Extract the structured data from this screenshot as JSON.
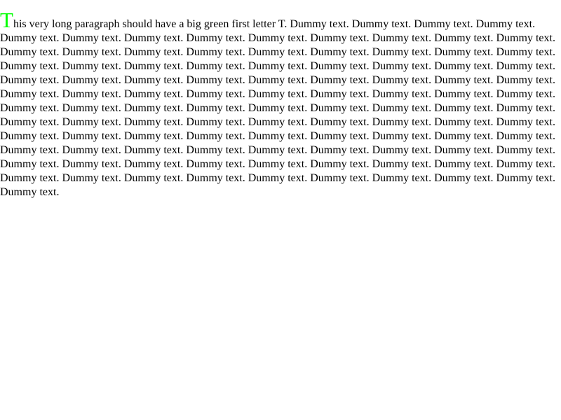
{
  "paragraph": {
    "first_letter": "T",
    "first_letter_color": "#00ff00",
    "lines": [
      "his very long paragraph should have a big green first letter T. Dummy text. Dummy text. Dummy text. Dummy text.",
      "Dummy text. Dummy text. Dummy text. Dummy text. Dummy text. Dummy text. Dummy text. Dummy text. Dummy text.",
      "Dummy text. Dummy text. Dummy text. Dummy text. Dummy text. Dummy text. Dummy text. Dummy text. Dummy text.",
      "Dummy text. Dummy text. Dummy text. Dummy text. Dummy text. Dummy text. Dummy text. Dummy text. Dummy text.",
      "Dummy text. Dummy text. Dummy text. Dummy text. Dummy text. Dummy text. Dummy text. Dummy text. Dummy text.",
      "Dummy text. Dummy text. Dummy text. Dummy text. Dummy text. Dummy text. Dummy text. Dummy text. Dummy text.",
      "Dummy text. Dummy text. Dummy text. Dummy text. Dummy text. Dummy text. Dummy text. Dummy text. Dummy text.",
      "Dummy text. Dummy text. Dummy text. Dummy text. Dummy text. Dummy text. Dummy text. Dummy text. Dummy text.",
      "Dummy text. Dummy text. Dummy text. Dummy text. Dummy text. Dummy text. Dummy text. Dummy text. Dummy text.",
      "Dummy text. Dummy text. Dummy text. Dummy text. Dummy text. Dummy text. Dummy text. Dummy text. Dummy text.",
      "Dummy text. Dummy text. Dummy text. Dummy text. Dummy text. Dummy text. Dummy text. Dummy text. Dummy text.",
      "Dummy text. Dummy text. Dummy text. Dummy text. Dummy text. Dummy text. Dummy text. Dummy text. Dummy text.",
      "Dummy text."
    ]
  }
}
